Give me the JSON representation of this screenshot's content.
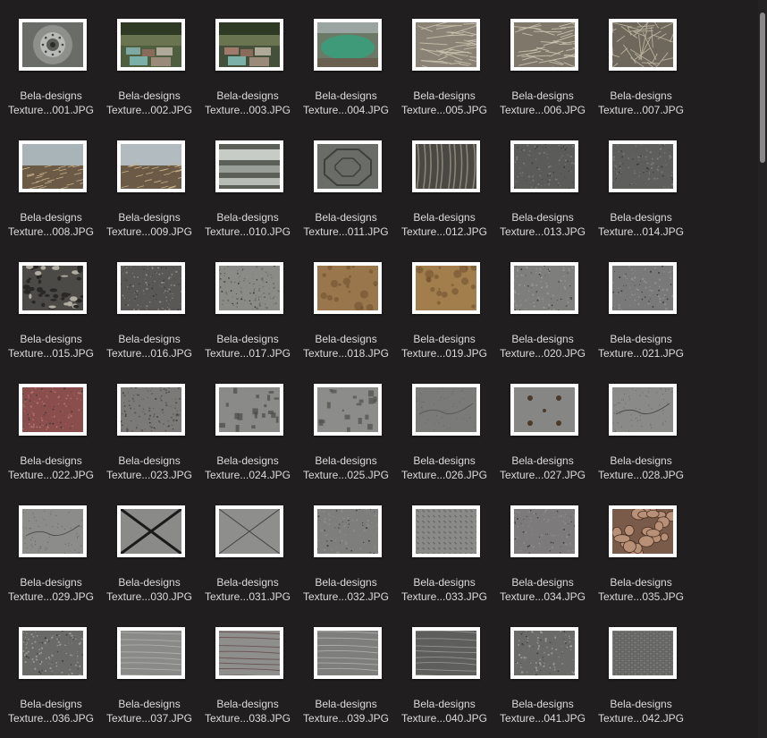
{
  "files": [
    {
      "line1": "Bela-designs",
      "line2": "Texture...001.JPG",
      "base": "#6a6c68",
      "accent": "#9aa09a",
      "pattern": "wheel"
    },
    {
      "line1": "Bela-designs",
      "line2": "Texture...002.JPG",
      "base": "#4f5e3e",
      "accent": "#7fa8a0",
      "pattern": "garden"
    },
    {
      "line1": "Bela-designs",
      "line2": "Texture...003.JPG",
      "base": "#44503a",
      "accent": "#a07a6a",
      "pattern": "garden"
    },
    {
      "line1": "Bela-designs",
      "line2": "Texture...004.JPG",
      "base": "#6a7a66",
      "accent": "#3f9a7a",
      "pattern": "pond"
    },
    {
      "line1": "Bela-designs",
      "line2": "Texture...005.JPG",
      "base": "#8a8274",
      "accent": "#cfc6b2",
      "pattern": "straw"
    },
    {
      "line1": "Bela-designs",
      "line2": "Texture...006.JPG",
      "base": "#7e776a",
      "accent": "#d2c8b4",
      "pattern": "straw"
    },
    {
      "line1": "Bela-designs",
      "line2": "Texture...007.JPG",
      "base": "#6e685c",
      "accent": "#c4baa4",
      "pattern": "nest"
    },
    {
      "line1": "Bela-designs",
      "line2": "Texture...008.JPG",
      "base": "#6b5a46",
      "accent": "#a9b4b8",
      "pattern": "field"
    },
    {
      "line1": "Bela-designs",
      "line2": "Texture...009.JPG",
      "base": "#6b5a46",
      "accent": "#b2bcc0",
      "pattern": "field"
    },
    {
      "line1": "Bela-designs",
      "line2": "Texture...010.JPG",
      "base": "#5c5e58",
      "accent": "#c8ccc6",
      "pattern": "planks"
    },
    {
      "line1": "Bela-designs",
      "line2": "Texture...011.JPG",
      "base": "#6a6c68",
      "accent": "#3e403c",
      "pattern": "octagon"
    },
    {
      "line1": "Bela-designs",
      "line2": "Texture...012.JPG",
      "base": "#4a4843",
      "accent": "#8a8478",
      "pattern": "bark"
    },
    {
      "line1": "Bela-designs",
      "line2": "Texture...013.JPG",
      "base": "#5b5c5a",
      "accent": "#777876",
      "pattern": "speckle"
    },
    {
      "line1": "Bela-designs",
      "line2": "Texture...014.JPG",
      "base": "#5e5f5d",
      "accent": "#7a7b79",
      "pattern": "speckle"
    },
    {
      "line1": "Bela-designs",
      "line2": "Texture...015.JPG",
      "base": "#4c4a46",
      "accent": "#b0aca2",
      "pattern": "gravel"
    },
    {
      "line1": "Bela-designs",
      "line2": "Texture...016.JPG",
      "base": "#5a5856",
      "accent": "#8a8886",
      "pattern": "speckle"
    },
    {
      "line1": "Bela-designs",
      "line2": "Texture...017.JPG",
      "base": "#8a8a86",
      "accent": "#6c6c68",
      "pattern": "speckle"
    },
    {
      "line1": "Bela-designs",
      "line2": "Texture...018.JPG",
      "base": "#8a6a44",
      "accent": "#b08a5a",
      "pattern": "rust"
    },
    {
      "line1": "Bela-designs",
      "line2": "Texture...019.JPG",
      "base": "#8e6c40",
      "accent": "#c09a60",
      "pattern": "rust"
    },
    {
      "line1": "Bela-designs",
      "line2": "Texture...020.JPG",
      "base": "#7e7e7c",
      "accent": "#969694",
      "pattern": "speckle"
    },
    {
      "line1": "Bela-designs",
      "line2": "Texture...021.JPG",
      "base": "#787978",
      "accent": "#90918f",
      "pattern": "speckle"
    },
    {
      "line1": "Bela-designs",
      "line2": "Texture...022.JPG",
      "base": "#8a4e4c",
      "accent": "#b0706c",
      "pattern": "speckle"
    },
    {
      "line1": "Bela-designs",
      "line2": "Texture...023.JPG",
      "base": "#7c7a78",
      "accent": "#5a5856",
      "pattern": "speckle"
    },
    {
      "line1": "Bela-designs",
      "line2": "Texture...024.JPG",
      "base": "#8a8a88",
      "accent": "#4a4a48",
      "pattern": "rough"
    },
    {
      "line1": "Bela-designs",
      "line2": "Texture...025.JPG",
      "base": "#8c8c8a",
      "accent": "#4e4e4c",
      "pattern": "rough"
    },
    {
      "line1": "Bela-designs",
      "line2": "Texture...026.JPG",
      "base": "#7a7a78",
      "accent": "#5a5a58",
      "pattern": "crack"
    },
    {
      "line1": "Bela-designs",
      "line2": "Texture...027.JPG",
      "base": "#868684",
      "accent": "#4a3a2a",
      "pattern": "bolts"
    },
    {
      "line1": "Bela-designs",
      "line2": "Texture...028.JPG",
      "base": "#8a8a88",
      "accent": "#4a4a48",
      "pattern": "crack"
    },
    {
      "line1": "Bela-designs",
      "line2": "Texture...029.JPG",
      "base": "#8c8c8a",
      "accent": "#505050",
      "pattern": "crack"
    },
    {
      "line1": "Bela-designs",
      "line2": "Texture...030.JPG",
      "base": "#8a8a88",
      "accent": "#1a1a1a",
      "pattern": "xbig"
    },
    {
      "line1": "Bela-designs",
      "line2": "Texture...031.JPG",
      "base": "#8e8e8c",
      "accent": "#444442",
      "pattern": "xthin"
    },
    {
      "line1": "Bela-designs",
      "line2": "Texture...032.JPG",
      "base": "#7e7e7c",
      "accent": "#8e8e8c",
      "pattern": "speckle"
    },
    {
      "line1": "Bela-designs",
      "line2": "Texture...033.JPG",
      "base": "#8a8a88",
      "accent": "#6a6a68",
      "pattern": "diamond"
    },
    {
      "line1": "Bela-designs",
      "line2": "Texture...034.JPG",
      "base": "#7c7a7a",
      "accent": "#8c8a8a",
      "pattern": "speckle"
    },
    {
      "line1": "Bela-designs",
      "line2": "Texture...035.JPG",
      "base": "#7a5a48",
      "accent": "#b89078",
      "pattern": "cobble"
    },
    {
      "line1": "Bela-designs",
      "line2": "Texture...036.JPG",
      "base": "#6a6a68",
      "accent": "#9a9a98",
      "pattern": "speckle"
    },
    {
      "line1": "Bela-designs",
      "line2": "Texture...037.JPG",
      "base": "#8a8a88",
      "accent": "#bcbcba",
      "pattern": "wood"
    },
    {
      "line1": "Bela-designs",
      "line2": "Texture...038.JPG",
      "base": "#8e8e8c",
      "accent": "#5a3a3a",
      "pattern": "wood"
    },
    {
      "line1": "Bela-designs",
      "line2": "Texture...039.JPG",
      "base": "#7e7e7c",
      "accent": "#c0c0be",
      "pattern": "wood"
    },
    {
      "line1": "Bela-designs",
      "line2": "Texture...040.JPG",
      "base": "#5e5e5c",
      "accent": "#a8a8a6",
      "pattern": "wood"
    },
    {
      "line1": "Bela-designs",
      "line2": "Texture...041.JPG",
      "base": "#6a6a68",
      "accent": "#9a9a98",
      "pattern": "speckle"
    },
    {
      "line1": "Bela-designs",
      "line2": "Texture...042.JPG",
      "base": "#7a7a78",
      "accent": "#4a4a48",
      "pattern": "grate"
    }
  ]
}
